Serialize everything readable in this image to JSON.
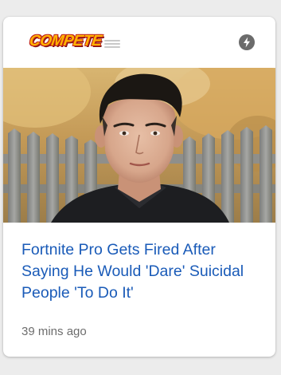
{
  "article": {
    "publisher": {
      "name": "COMPETE",
      "logo_color": "#ffb400",
      "logo_outline_color": "#c0241b"
    },
    "amp_icon": "amp-lightning-icon",
    "image": {
      "subject": "photo of a young man with a dark undercut hairstyle in front of a weathered wooden fence",
      "dominant_colors": [
        "#c9a668",
        "#8a8b8a",
        "#1e1f21"
      ]
    },
    "headline": "Fortnite Pro Gets Fired After Saying He Would 'Dare' Suicidal People 'To Do It'",
    "headline_color": "#1a5bb8",
    "timestamp": "39 mins ago"
  }
}
